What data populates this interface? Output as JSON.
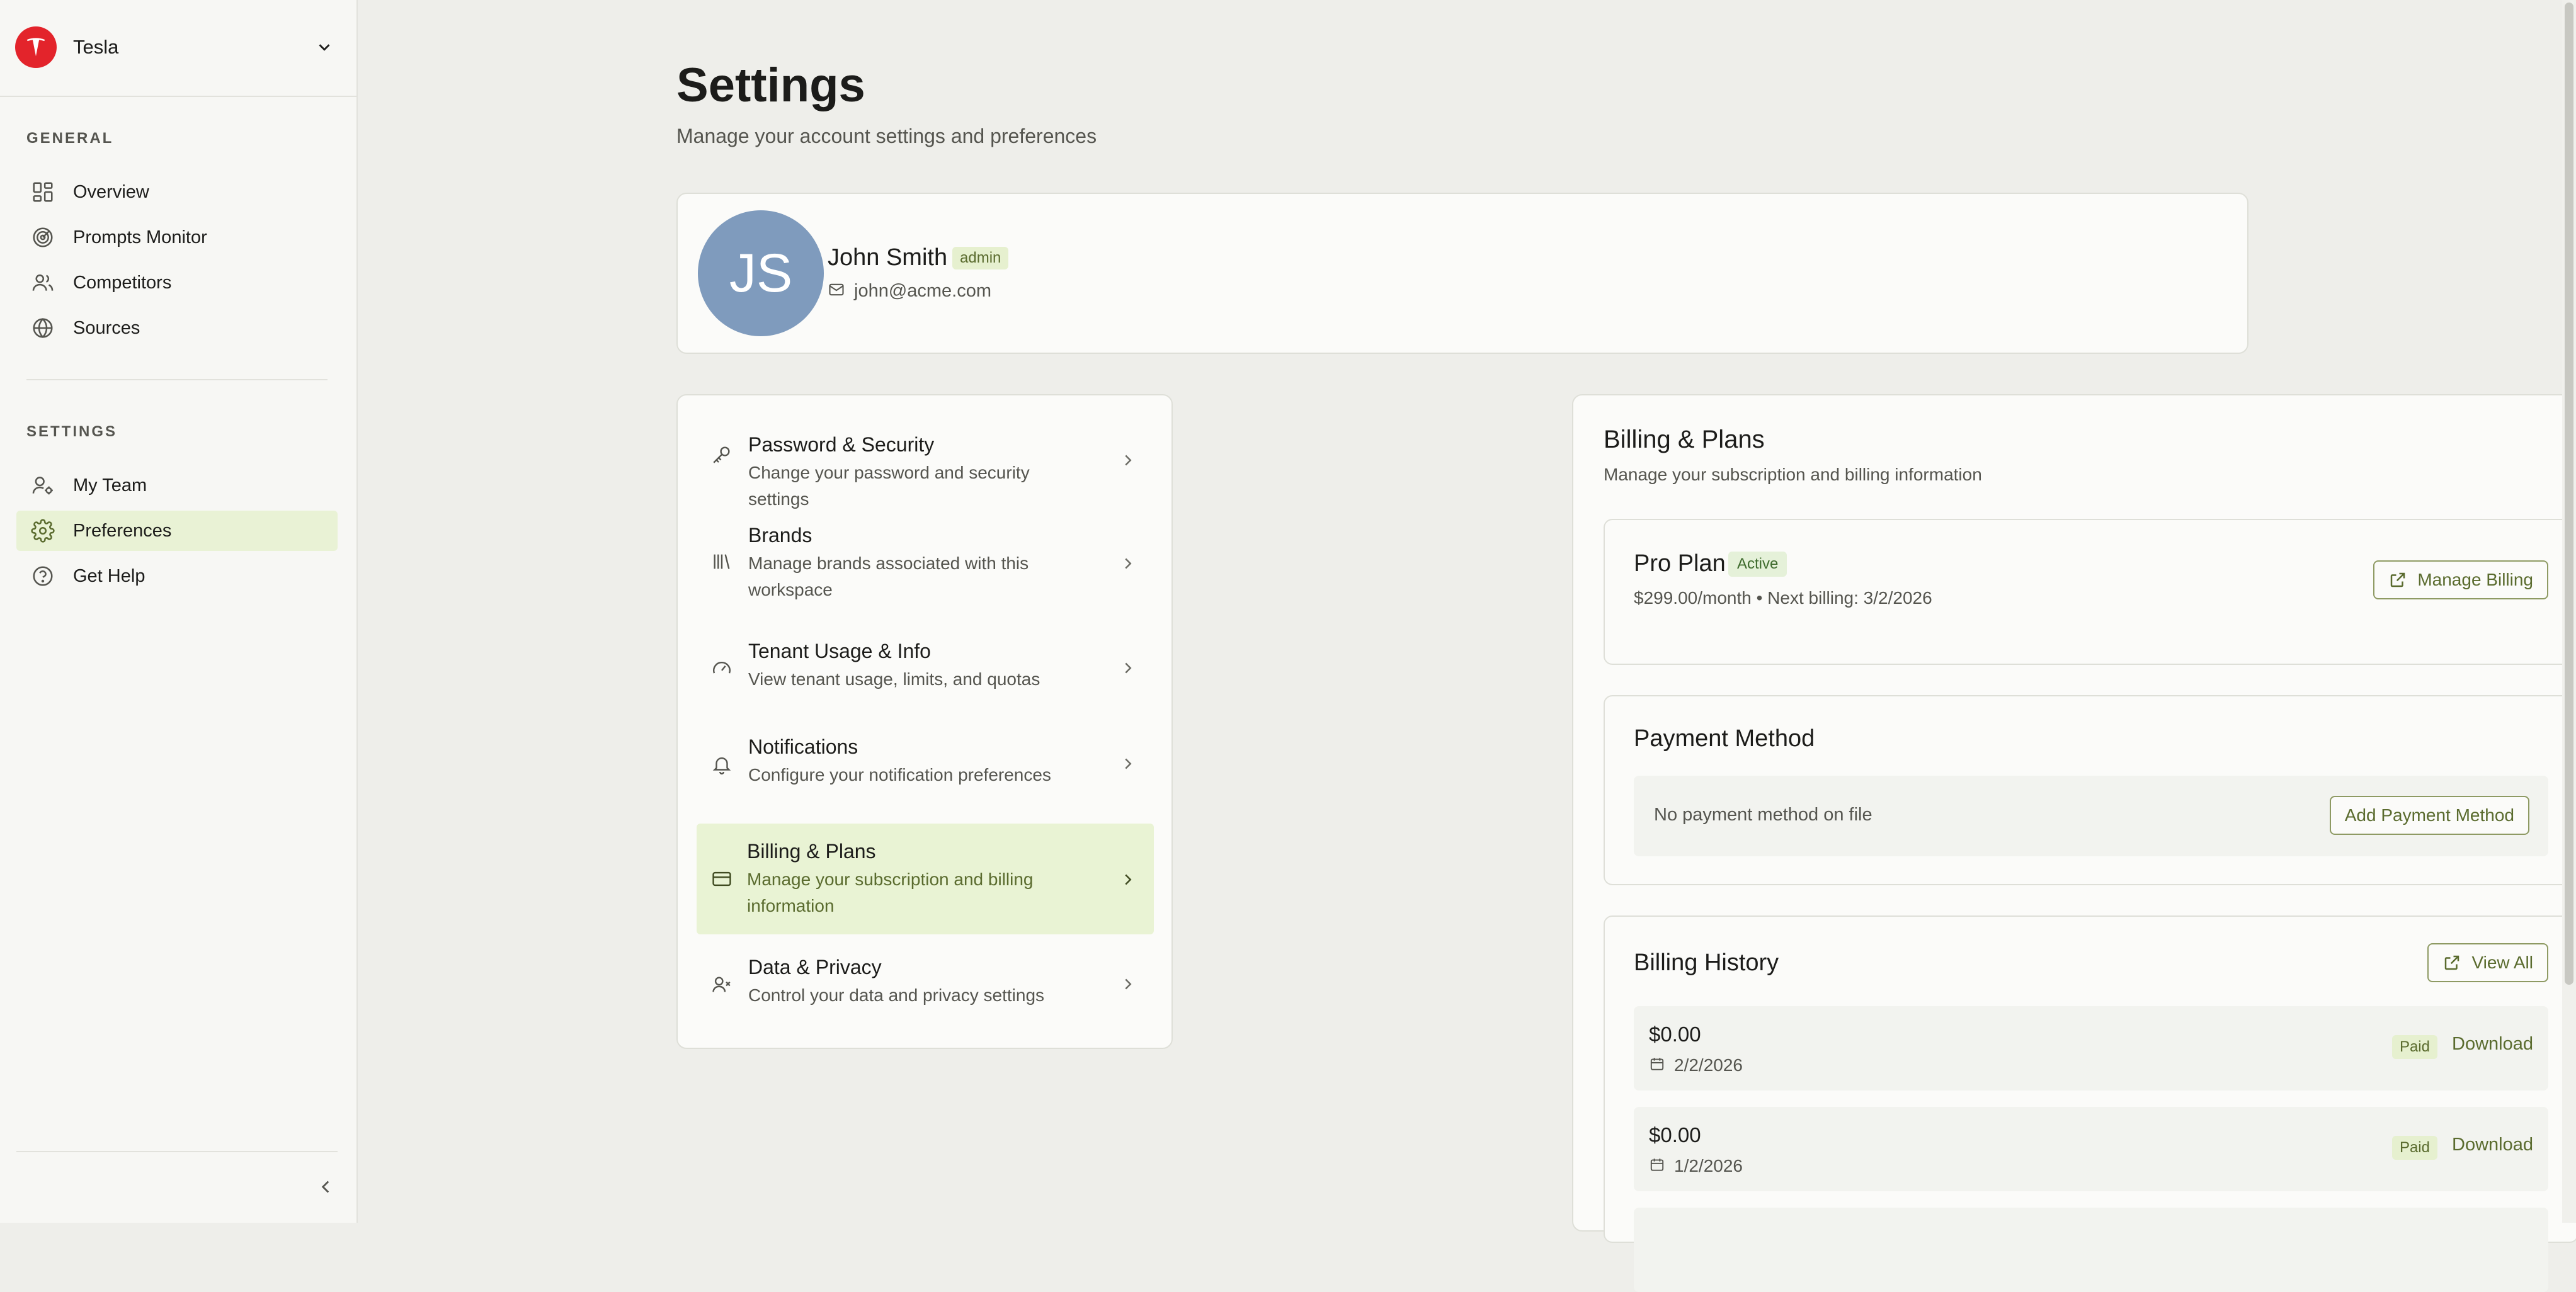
{
  "workspace": {
    "name": "Tesla",
    "logo_icon": "tesla-logo",
    "brand_color": "#e3242b"
  },
  "sidebar": {
    "general_heading": "GENERAL",
    "general_items": [
      {
        "label": "Overview",
        "icon": "dashboard-grid-icon"
      },
      {
        "label": "Prompts Monitor",
        "icon": "radar-icon"
      },
      {
        "label": "Competitors",
        "icon": "users-icon"
      },
      {
        "label": "Sources",
        "icon": "globe-icon"
      }
    ],
    "settings_heading": "SETTINGS",
    "settings_items": [
      {
        "label": "My Team",
        "icon": "user-gear-icon"
      },
      {
        "label": "Preferences",
        "icon": "gear-icon",
        "active": true
      },
      {
        "label": "Get Help",
        "icon": "help-circle-icon"
      }
    ]
  },
  "page": {
    "title": "Settings",
    "subtitle": "Manage your account settings and preferences"
  },
  "profile": {
    "initials": "JS",
    "name": "John Smith",
    "role": "admin",
    "email": "john@acme.com",
    "avatar_color": "#7f9bbd"
  },
  "settings_menu": [
    {
      "title": "Password & Security",
      "subtitle": "Change your password and security settings",
      "icon": "key-icon"
    },
    {
      "title": "Brands",
      "subtitle": "Manage brands associated with this workspace",
      "icon": "library-icon"
    },
    {
      "title": "Tenant Usage & Info",
      "subtitle": "View tenant usage, limits, and quotas",
      "icon": "gauge-icon"
    },
    {
      "title": "Notifications",
      "subtitle": "Configure your notification preferences",
      "icon": "bell-icon"
    },
    {
      "title": "Billing & Plans",
      "subtitle": "Manage your subscription and billing information",
      "icon": "credit-card-icon",
      "active": true
    },
    {
      "title": "Data & Privacy",
      "subtitle": "Control your data and privacy settings",
      "icon": "user-x-icon"
    }
  ],
  "billing": {
    "title": "Billing & Plans",
    "subtitle": "Manage your subscription and billing information",
    "plan": {
      "name": "Pro Plan",
      "status": "Active",
      "price_line": "$299.00/month • Next billing: 3/2/2026",
      "manage_label": "Manage Billing"
    },
    "payment": {
      "title": "Payment Method",
      "empty_text": "No payment method on file",
      "add_label": "Add Payment Method"
    },
    "history": {
      "title": "Billing History",
      "view_all_label": "View All",
      "items": [
        {
          "amount": "$0.00",
          "date": "2/2/2026",
          "status": "Paid",
          "action": "Download"
        },
        {
          "amount": "$0.00",
          "date": "1/2/2026",
          "status": "Paid",
          "action": "Download"
        }
      ]
    }
  },
  "colors": {
    "accent": "#5a6b2e",
    "active_bg": "#e9f2d5",
    "page_bg": "#eeeeea"
  }
}
